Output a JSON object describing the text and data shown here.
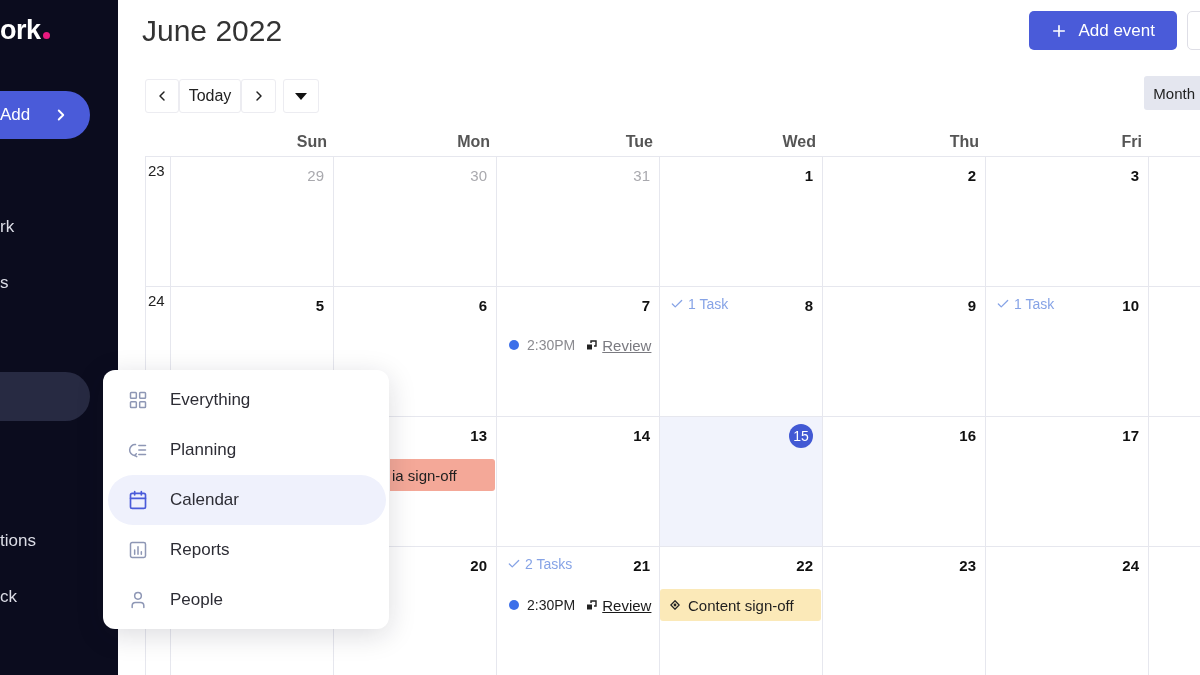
{
  "sidebar": {
    "logo": "ork",
    "add_button": {
      "label": "Add"
    },
    "items": [
      {
        "label": "rk",
        "selected": false
      },
      {
        "label": "s",
        "selected": false
      },
      {
        "selected": true
      },
      {
        "label": "tions",
        "selected": false
      },
      {
        "label": "ck",
        "selected": false
      }
    ]
  },
  "header": {
    "title": "June 2022",
    "add_event_button": {
      "label": "Add event"
    }
  },
  "toolbar": {
    "today_button": {
      "label": "Today"
    },
    "view_button": {
      "label": "Month"
    }
  },
  "calendar": {
    "columns": [
      "Sun",
      "Mon",
      "Tue",
      "Wed",
      "Thu",
      "Fri"
    ],
    "weeks": [
      {
        "week": "23",
        "days": [
          {
            "kind": "day",
            "day": "29",
            "muted": true,
            "today": false
          },
          {
            "kind": "day",
            "day": "30",
            "muted": true,
            "today": false
          },
          {
            "kind": "day",
            "day": "31",
            "muted": true,
            "today": false
          },
          {
            "kind": "day",
            "day": "1",
            "muted": false,
            "today": false
          },
          {
            "kind": "day",
            "day": "2",
            "muted": false,
            "today": false
          },
          {
            "kind": "day",
            "day": "3",
            "muted": false,
            "today": false
          },
          {
            "kind": "blank"
          }
        ]
      },
      {
        "week": "24",
        "days": [
          {
            "kind": "day",
            "day": "5",
            "muted": false,
            "today": false
          },
          {
            "kind": "day",
            "day": "6",
            "muted": false,
            "today": false
          },
          {
            "kind": "day",
            "day": "7",
            "muted": false,
            "today": false,
            "events": [
              {
                "kind": "timed",
                "time": "2:30PM",
                "title": "Review",
                "past": true
              }
            ]
          },
          {
            "kind": "day",
            "day": "8",
            "muted": false,
            "today": false,
            "tasks": "1 Task"
          },
          {
            "kind": "day",
            "day": "9",
            "muted": false,
            "today": false
          },
          {
            "kind": "day",
            "day": "10",
            "muted": false,
            "today": false,
            "tasks": "1 Task"
          },
          {
            "kind": "blank"
          }
        ]
      },
      {
        "days": [
          {
            "kind": "blank"
          },
          {
            "kind": "day",
            "day": "13",
            "muted": false,
            "today": false,
            "events": [
              {
                "kind": "bar",
                "title": "ia sign-off",
                "color": "#f4a898",
                "continued": true
              }
            ]
          },
          {
            "kind": "day",
            "day": "14",
            "muted": false,
            "today": false
          },
          {
            "kind": "day",
            "day": "15",
            "muted": false,
            "today": true
          },
          {
            "kind": "day",
            "day": "16",
            "muted": false,
            "today": false
          },
          {
            "kind": "day",
            "day": "17",
            "muted": false,
            "today": false
          },
          {
            "kind": "blank"
          }
        ]
      },
      {
        "days": [
          {
            "kind": "blank"
          },
          {
            "kind": "day",
            "day": "20",
            "muted": false,
            "today": false
          },
          {
            "kind": "day",
            "day": "21",
            "muted": false,
            "today": false,
            "tasks": "2 Tasks",
            "events": [
              {
                "kind": "timed",
                "time": "2:30PM",
                "title": "Review",
                "past": false
              }
            ]
          },
          {
            "kind": "day",
            "day": "22",
            "muted": false,
            "today": false,
            "events": [
              {
                "kind": "bar",
                "title": "Content sign-off",
                "color": "#fbe9b8",
                "continued": false
              }
            ]
          },
          {
            "kind": "day",
            "day": "23",
            "muted": false,
            "today": false
          },
          {
            "kind": "day",
            "day": "24",
            "muted": false,
            "today": false
          },
          {
            "kind": "blank"
          }
        ]
      }
    ]
  },
  "view_menu": {
    "items": [
      {
        "label": "Everything",
        "kind": "grid",
        "selected": false
      },
      {
        "label": "Planning",
        "kind": "planning",
        "selected": false
      },
      {
        "label": "Calendar",
        "kind": "calendar",
        "selected": true
      },
      {
        "label": "Reports",
        "kind": "reports",
        "selected": false
      },
      {
        "label": "People",
        "kind": "people",
        "selected": false
      }
    ]
  }
}
